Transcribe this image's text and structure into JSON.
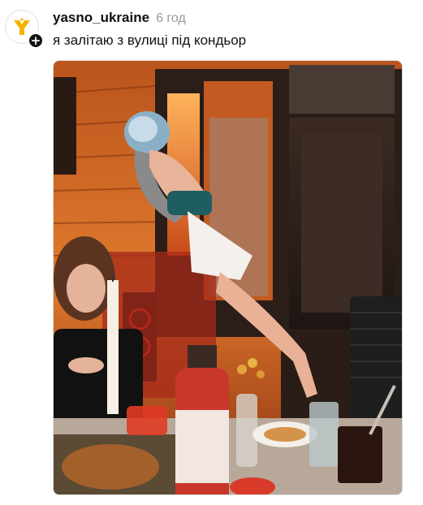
{
  "post": {
    "username": "yasno_ukraine",
    "timestamp": "6 год",
    "caption": "я залітаю з вулиці під кондьор",
    "follow_badge": "+",
    "avatar_icon": "yasno-logo-icon",
    "media_icon": "video-frame"
  },
  "colors": {
    "brand_yellow": "#f5b400",
    "text": "#111111",
    "muted": "#999999"
  }
}
